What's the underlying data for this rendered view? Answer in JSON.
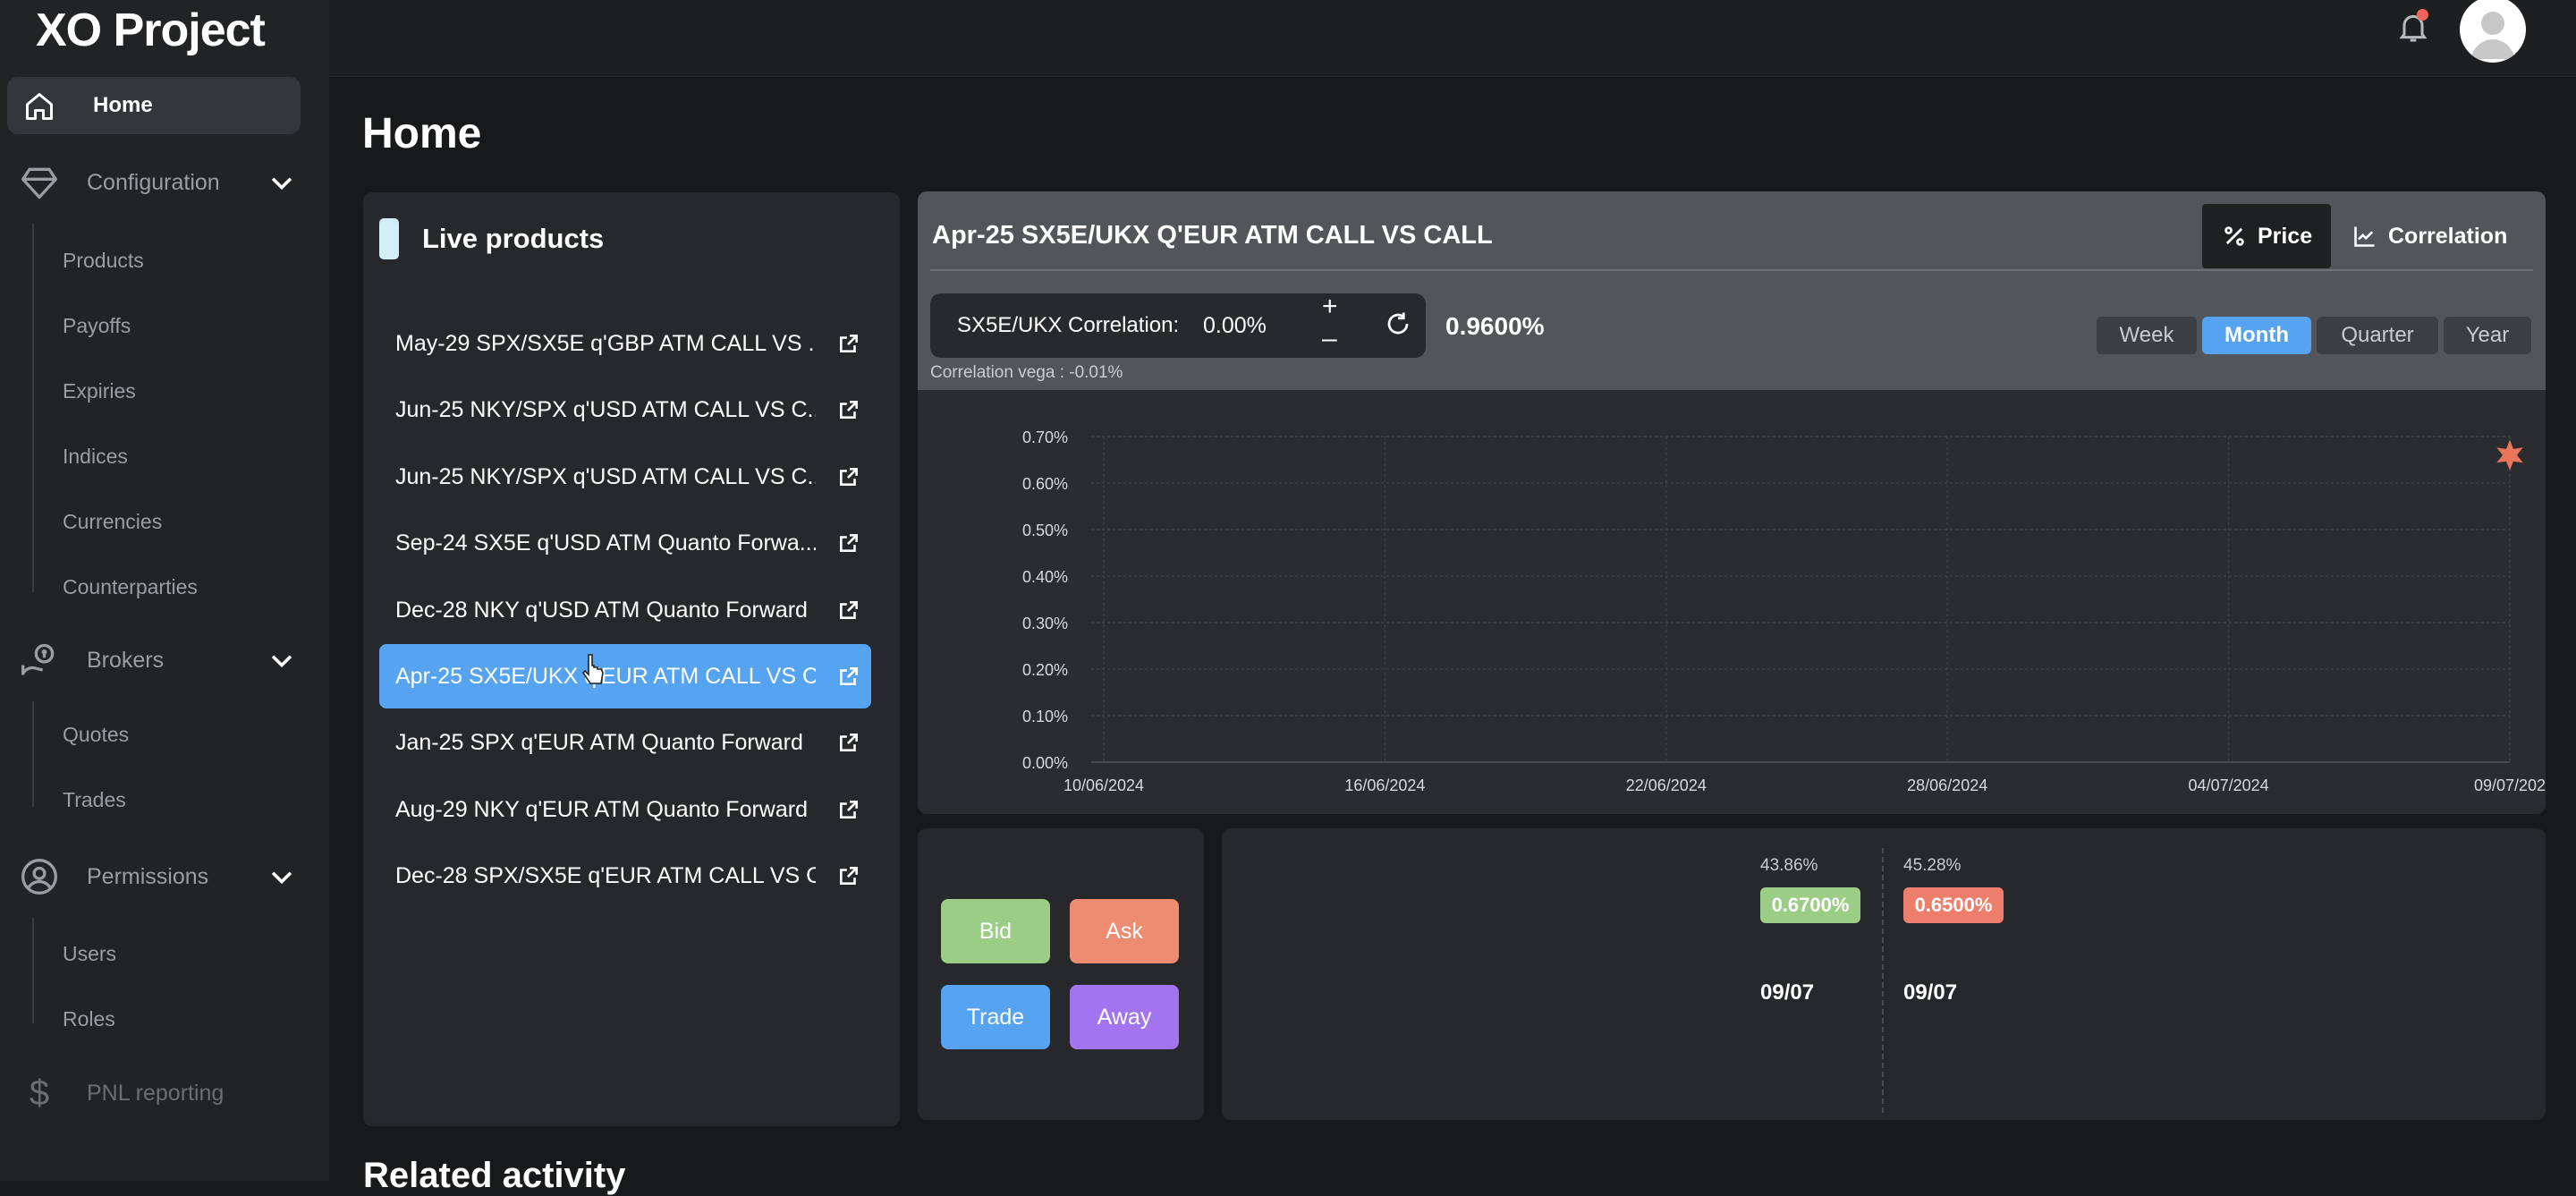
{
  "app": {
    "title": "XO Project"
  },
  "sidebar": {
    "home_label": "Home",
    "configuration": {
      "label": "Configuration",
      "items": [
        "Products",
        "Payoffs",
        "Expiries",
        "Indices",
        "Currencies",
        "Counterparties"
      ]
    },
    "brokers": {
      "label": "Brokers",
      "items": [
        "Quotes",
        "Trades"
      ]
    },
    "permissions": {
      "label": "Permissions",
      "items": [
        "Users",
        "Roles"
      ]
    },
    "pnl_label": "PNL reporting"
  },
  "page": {
    "title": "Home",
    "related_title": "Related activity"
  },
  "live_products": {
    "title": "Live products",
    "items": [
      {
        "label": "May-29 SPX/SX5E q'GBP ATM CALL VS ..."
      },
      {
        "label": "Jun-25 NKY/SPX q'USD ATM CALL VS C..."
      },
      {
        "label": "Jun-25 NKY/SPX q'USD ATM CALL VS C..."
      },
      {
        "label": "Sep-24 SX5E q'USD ATM Quanto Forwa..."
      },
      {
        "label": "Dec-28 NKY q'USD ATM Quanto Forward"
      },
      {
        "label": "Apr-25 SX5E/UKX q'EUR ATM CALL VS C..."
      },
      {
        "label": "Jan-25 SPX q'EUR ATM Quanto Forward"
      },
      {
        "label": "Aug-29 NKY q'EUR ATM Quanto Forward"
      },
      {
        "label": "Dec-28 SPX/SX5E q'EUR ATM CALL VS C..."
      }
    ],
    "active_index": 5
  },
  "detail": {
    "title": "Apr-25 SX5E/UKX Q'EUR ATM CALL VS CALL",
    "tabs": {
      "price": "Price",
      "correlation": "Correlation"
    },
    "correlation_label": "SX5E/UKX Correlation:",
    "correlation_value": "0.00%",
    "plus": "+",
    "minus": "–",
    "result": "0.9600%",
    "vega": "Correlation vega : -0.01%",
    "periods": [
      "Week",
      "Month",
      "Quarter",
      "Year"
    ],
    "active_period": "Month"
  },
  "chart_data": {
    "type": "scatter",
    "x_ticks": [
      "10/06/2024",
      "16/06/2024",
      "22/06/2024",
      "28/06/2024",
      "04/07/2024",
      "09/07/202"
    ],
    "y_ticks": [
      "0.00%",
      "0.10%",
      "0.20%",
      "0.30%",
      "0.40%",
      "0.50%",
      "0.60%",
      "0.70%"
    ],
    "ylim": [
      0,
      0.7
    ],
    "xlim": [
      "10/06/2024",
      "09/07/2024"
    ],
    "grid": true,
    "series": [
      {
        "points": [
          {
            "x": "09/07/2024",
            "y": 0.66
          }
        ],
        "marker": "star",
        "color": "#e9765a"
      }
    ]
  },
  "actions": {
    "bid": "Bid",
    "ask": "Ask",
    "trade": "Trade",
    "away": "Away"
  },
  "quotes": {
    "bid": {
      "pct": "43.86%",
      "value": "0.6700%",
      "date": "09/07"
    },
    "ask": {
      "pct": "45.28%",
      "value": "0.6500%",
      "date": "09/07"
    }
  },
  "colors": {
    "accent": "#56a3f1",
    "bid": "#9ccd87",
    "ask": "#ee8c72",
    "trade": "#56a3f1",
    "away": "#a274ef",
    "quote_bid": "#9ccd87",
    "quote_ask": "#ee7e6c",
    "marker": "#e9765a"
  }
}
